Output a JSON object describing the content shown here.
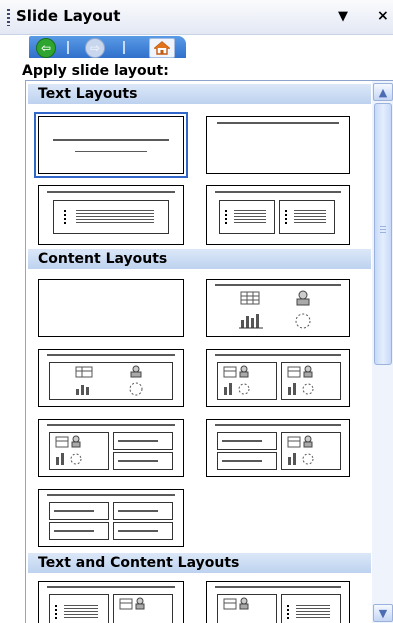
{
  "panel": {
    "title": "Slide Layout",
    "dropdown_icon": "chevron-down-icon",
    "close_label": "×"
  },
  "nav": {
    "back_icon": "back-arrow-icon",
    "forward_icon": "forward-arrow-icon",
    "home_icon": "home-icon"
  },
  "apply_label": "Apply slide layout:",
  "sections": {
    "text_layouts": "Text Layouts",
    "content_layouts": "Content Layouts",
    "text_and_content_layouts": "Text and Content Layouts"
  },
  "colors": {
    "accent": "#3067c9",
    "header_bg": "#c6d8f1",
    "nav_bg": "#3f7fd6"
  }
}
